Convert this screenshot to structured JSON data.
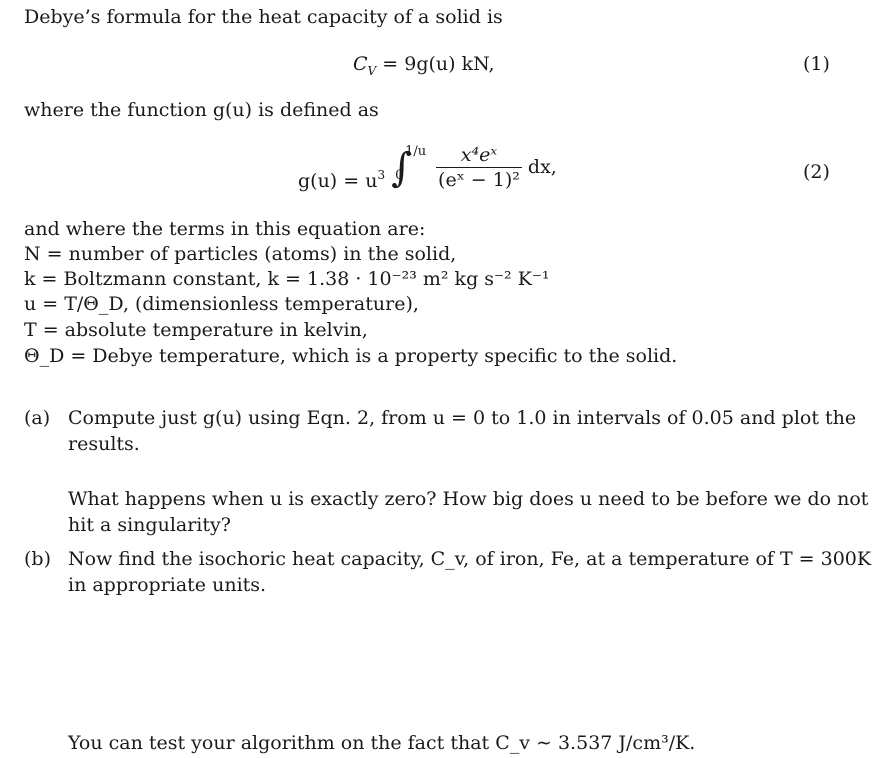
{
  "intro": "Debye’s formula for the heat capacity of a solid is",
  "eq1": {
    "lhs": "C",
    "lhs_sub": "V",
    "rhs": "= 9g(u) kN,",
    "number": "(1)"
  },
  "function_intro": "where the function g(u) is defined as",
  "eq2": {
    "lhs": "g(u) = u",
    "lhs_sup": "3",
    "upper_limit": "1/u",
    "lower_limit": "0",
    "numerator": "x⁴eˣ",
    "denominator": "(eˣ − 1)²",
    "differential": "dx,",
    "number": "(2)"
  },
  "terms_intro": "and where the terms in this equation are:",
  "terms": [
    "N = number of particles (atoms) in the solid,",
    "k = Boltzmann constant, k = 1.38 · 10⁻²³ m² kg s⁻² K⁻¹",
    "u = T/Θ_D, (dimensionless temperature),",
    "T = absolute temperature in kelvin,",
    "Θ_D = Debye temperature, which is a property specific to the solid."
  ],
  "parts": {
    "a": {
      "label": "(a)",
      "line1": "Compute just g(u) using Eqn. 2, from u = 0 to 1.0 in intervals of 0.05 and plot the",
      "line2": "results.",
      "q1": "What happens when u is exactly zero? How big does u need to be before we do not",
      "q2": "hit a singularity?"
    },
    "b": {
      "label": "(b)",
      "line1": "Now find the isochoric heat capacity, C_v, of iron, Fe, at a temperature of T = 300K",
      "line2": "in appropriate units."
    }
  },
  "test_hint": "You can test your algorithm on the fact that C_v ∼ 3.537 J/cm³/K."
}
